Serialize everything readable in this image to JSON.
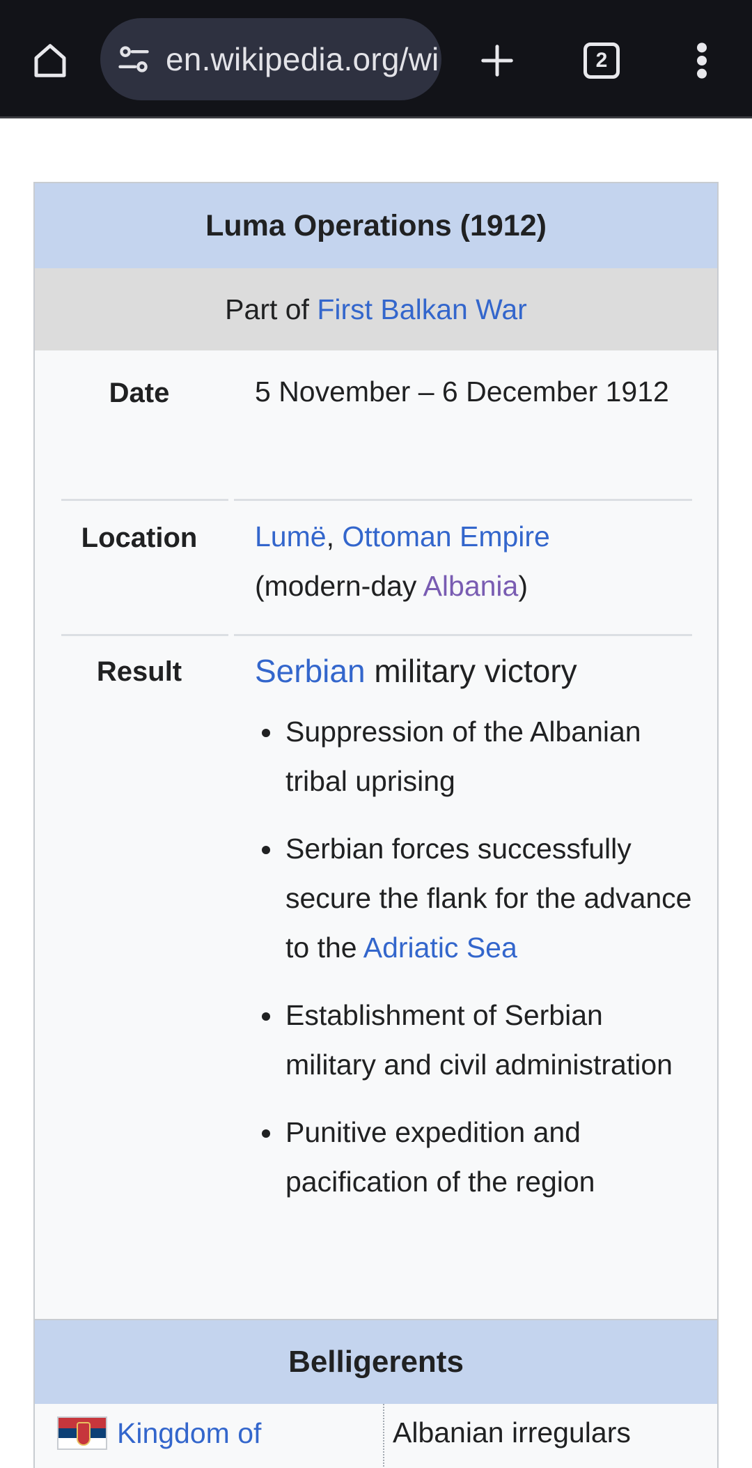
{
  "browser": {
    "url": "en.wikipedia.org/wiki/Luma_Operations",
    "tab_count": "2",
    "icons": {
      "home": "home-icon",
      "site_info": "tune-icon",
      "new_tab": "plus-icon",
      "tabs": "tab-switcher-icon",
      "menu": "more-vert-icon"
    }
  },
  "infobox": {
    "title": "Luma Operations (1912)",
    "part_of_prefix": "Part of ",
    "part_of_link": "First Balkan War",
    "date": {
      "label": "Date",
      "value": "5 November – 6 December 1912"
    },
    "location": {
      "label": "Location",
      "link1": "Lumë",
      "comma": ", ",
      "link2": "Ottoman Empire",
      "open": "(modern-day ",
      "link3": "Albania",
      "close": ")"
    },
    "result": {
      "label": "Result",
      "lead_link": "Serbian",
      "lead_text": " military victory",
      "bullets": [
        "Suppression of the Albanian tribal uprising",
        "Serbian forces successfully secure the flank for the advance to the ",
        "Establishment of Serbian military and civil administration",
        "Punitive expedition and pacification of the region"
      ],
      "bullet2_link": "Adriatic Sea"
    },
    "belligerents": {
      "heading": "Belligerents",
      "left_link": "Kingdom of",
      "right_text": "Albanian irregulars",
      "flag": "serbia-flag"
    }
  },
  "colors": {
    "link": "#3366cc",
    "visited_link": "#795cb2",
    "header_bg": "#c4d4ee",
    "subheader_bg": "#dcdcdc",
    "topbar_bg": "#121318"
  }
}
